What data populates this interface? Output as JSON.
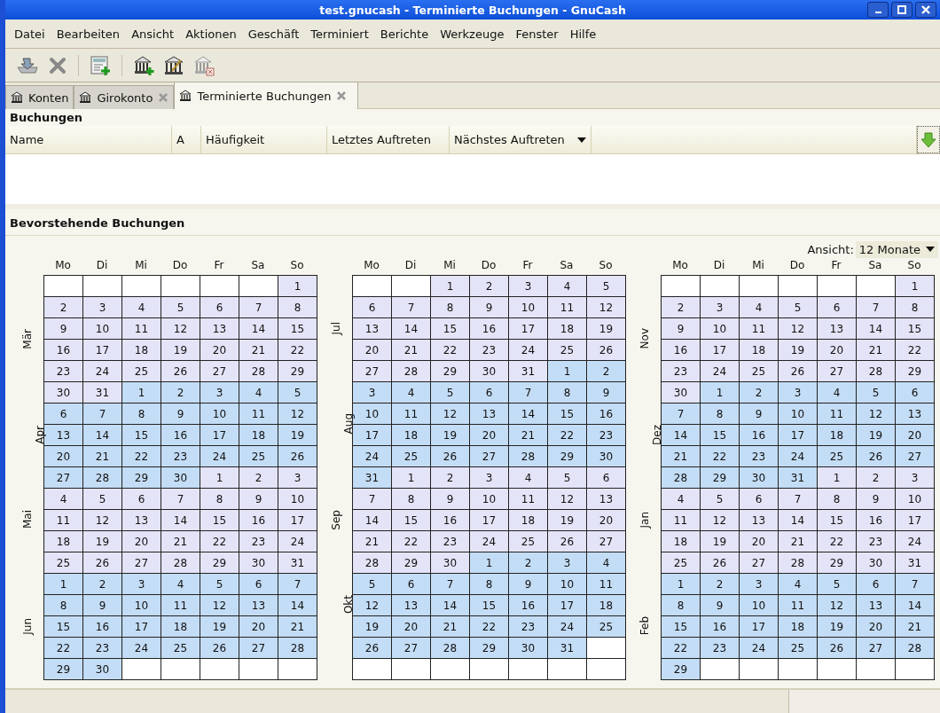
{
  "window": {
    "title": "test.gnucash - Terminierte Buchungen - GnuCash"
  },
  "menu": [
    "Datei",
    "Bearbeiten",
    "Ansicht",
    "Aktionen",
    "Geschäft",
    "Terminiert",
    "Berichte",
    "Werkzeuge",
    "Fenster",
    "Hilfe"
  ],
  "tabs": [
    {
      "label": "Konten",
      "selected": false,
      "closable": false
    },
    {
      "label": "Girokonto",
      "selected": false,
      "closable": true
    },
    {
      "label": "Terminierte Buchungen",
      "selected": true,
      "closable": true
    }
  ],
  "transactions": {
    "title": "Buchungen",
    "columns": [
      {
        "label": "Name",
        "sorted": false
      },
      {
        "label": "A",
        "sorted": false
      },
      {
        "label": "Häufigkeit",
        "sorted": false
      },
      {
        "label": "Letztes Auftreten",
        "sorted": false
      },
      {
        "label": "Nächstes Auftreten",
        "sorted": true
      }
    ]
  },
  "upcoming": {
    "title": "Bevorstehende Buchungen",
    "view_label": "Ansicht:",
    "view_value": "12 Monate",
    "columns": [
      {
        "weekdays": [
          "Mo",
          "Di",
          "Mi",
          "Do",
          "Fr",
          "Sa",
          "So"
        ],
        "months": [
          {
            "label": "Mär",
            "color": "#e4e4f8",
            "weeks": [
              [
                "1"
              ],
              [
                "2",
                "3",
                "4",
                "5",
                "6",
                "7",
                "8"
              ],
              [
                "9",
                "10",
                "11",
                "12",
                "13",
                "14",
                "15"
              ],
              [
                "16",
                "17",
                "18",
                "19",
                "20",
                "21",
                "22"
              ],
              [
                "23",
                "24",
                "25",
                "26",
                "27",
                "28",
                "29"
              ],
              [
                "30",
                "31"
              ]
            ]
          },
          {
            "label": "Apr",
            "color": "#c4ddf6",
            "weeks": [
              [
                "1",
                "2",
                "3",
                "4",
                "5"
              ],
              [
                "6",
                "7",
                "8",
                "9",
                "10",
                "11",
                "12"
              ],
              [
                "13",
                "14",
                "15",
                "16",
                "17",
                "18",
                "19"
              ],
              [
                "20",
                "21",
                "22",
                "23",
                "24",
                "25",
                "26"
              ],
              [
                "27",
                "28",
                "29",
                "30"
              ]
            ]
          },
          {
            "label": "Mai",
            "color": "#e4e4f8",
            "weeks": [
              [
                "1",
                "2",
                "3"
              ],
              [
                "4",
                "5",
                "6",
                "7",
                "8",
                "9",
                "10"
              ],
              [
                "11",
                "12",
                "13",
                "14",
                "15",
                "16",
                "17"
              ],
              [
                "18",
                "19",
                "20",
                "21",
                "22",
                "23",
                "24"
              ],
              [
                "25",
                "26",
                "27",
                "28",
                "29",
                "30",
                "31"
              ]
            ]
          },
          {
            "label": "Jun",
            "color": "#c4ddf6",
            "weeks": [
              [
                "1",
                "2",
                "3",
                "4",
                "5",
                "6",
                "7"
              ],
              [
                "8",
                "9",
                "10",
                "11",
                "12",
                "13",
                "14"
              ],
              [
                "15",
                "16",
                "17",
                "18",
                "19",
                "20",
                "21"
              ],
              [
                "22",
                "23",
                "24",
                "25",
                "26",
                "27",
                "28"
              ],
              [
                "29",
                "30"
              ]
            ]
          }
        ]
      },
      {
        "weekdays": [
          "Mo",
          "Di",
          "Mi",
          "Do",
          "Fr",
          "Sa",
          "So"
        ],
        "months": [
          {
            "label": "Jul",
            "color": "#e4e4f8",
            "weeks": [
              [
                "1",
                "2",
                "3",
                "4",
                "5"
              ],
              [
                "6",
                "7",
                "8",
                "9",
                "10",
                "11",
                "12"
              ],
              [
                "13",
                "14",
                "15",
                "16",
                "17",
                "18",
                "19"
              ],
              [
                "20",
                "21",
                "22",
                "23",
                "24",
                "25",
                "26"
              ],
              [
                "27",
                "28",
                "29",
                "30",
                "31"
              ]
            ]
          },
          {
            "label": "Aug",
            "color": "#c4ddf6",
            "weeks": [
              [
                "1",
                "2"
              ],
              [
                "3",
                "4",
                "5",
                "6",
                "7",
                "8",
                "9"
              ],
              [
                "10",
                "11",
                "12",
                "13",
                "14",
                "15",
                "16"
              ],
              [
                "17",
                "18",
                "19",
                "20",
                "21",
                "22",
                "23"
              ],
              [
                "24",
                "25",
                "26",
                "27",
                "28",
                "29",
                "30"
              ],
              [
                "31"
              ]
            ]
          },
          {
            "label": "Sep",
            "color": "#e4e4f8",
            "weeks": [
              [
                "1",
                "2",
                "3",
                "4",
                "5",
                "6"
              ],
              [
                "7",
                "8",
                "9",
                "10",
                "11",
                "12",
                "13"
              ],
              [
                "14",
                "15",
                "16",
                "17",
                "18",
                "19",
                "20"
              ],
              [
                "21",
                "22",
                "23",
                "24",
                "25",
                "26",
                "27"
              ],
              [
                "28",
                "29",
                "30"
              ]
            ]
          },
          {
            "label": "Okt",
            "color": "#c4ddf6",
            "weeks": [
              [
                "1",
                "2",
                "3",
                "4"
              ],
              [
                "5",
                "6",
                "7",
                "8",
                "9",
                "10",
                "11"
              ],
              [
                "12",
                "13",
                "14",
                "15",
                "16",
                "17",
                "18"
              ],
              [
                "19",
                "20",
                "21",
                "22",
                "23",
                "24",
                "25"
              ],
              [
                "26",
                "27",
                "28",
                "29",
                "30",
                "31"
              ]
            ]
          }
        ]
      },
      {
        "weekdays": [
          "Mo",
          "Di",
          "Mi",
          "Do",
          "Fr",
          "Sa",
          "So"
        ],
        "months": [
          {
            "label": "Nov",
            "color": "#e4e4f8",
            "weeks": [
              [
                "1"
              ],
              [
                "2",
                "3",
                "4",
                "5",
                "6",
                "7",
                "8"
              ],
              [
                "9",
                "10",
                "11",
                "12",
                "13",
                "14",
                "15"
              ],
              [
                "16",
                "17",
                "18",
                "19",
                "20",
                "21",
                "22"
              ],
              [
                "23",
                "24",
                "25",
                "26",
                "27",
                "28",
                "29"
              ],
              [
                "30"
              ]
            ]
          },
          {
            "label": "Dez",
            "color": "#c4ddf6",
            "weeks": [
              [
                "1",
                "2",
                "3",
                "4",
                "5",
                "6"
              ],
              [
                "7",
                "8",
                "9",
                "10",
                "11",
                "12",
                "13"
              ],
              [
                "14",
                "15",
                "16",
                "17",
                "18",
                "19",
                "20"
              ],
              [
                "21",
                "22",
                "23",
                "24",
                "25",
                "26",
                "27"
              ],
              [
                "28",
                "29",
                "30",
                "31"
              ]
            ]
          },
          {
            "label": "Jan",
            "color": "#e4e4f8",
            "weeks": [
              [
                "1",
                "2",
                "3"
              ],
              [
                "4",
                "5",
                "6",
                "7",
                "8",
                "9",
                "10"
              ],
              [
                "11",
                "12",
                "13",
                "14",
                "15",
                "16",
                "17"
              ],
              [
                "18",
                "19",
                "20",
                "21",
                "22",
                "23",
                "24"
              ],
              [
                "25",
                "26",
                "27",
                "28",
                "29",
                "30",
                "31"
              ]
            ]
          },
          {
            "label": "Feb",
            "color": "#c4ddf6",
            "weeks": [
              [
                "1",
                "2",
                "3",
                "4",
                "5",
                "6",
                "7"
              ],
              [
                "8",
                "9",
                "10",
                "11",
                "12",
                "13",
                "14"
              ],
              [
                "15",
                "16",
                "17",
                "18",
                "19",
                "20",
                "21"
              ],
              [
                "22",
                "23",
                "24",
                "25",
                "26",
                "27",
                "28"
              ],
              [
                "29"
              ]
            ]
          }
        ]
      }
    ]
  }
}
